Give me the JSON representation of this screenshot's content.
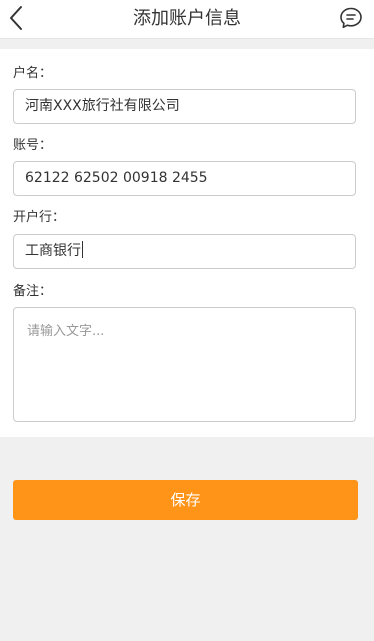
{
  "header": {
    "title": "添加账户信息",
    "back_icon": "chevron-left-icon",
    "chat_icon": "chat-bubble-icon"
  },
  "form": {
    "account_name": {
      "label": "户名：",
      "value": "河南XXX旅行社有限公司"
    },
    "account_number": {
      "label": "账号：",
      "value": "62122 62502 00918 2455"
    },
    "bank": {
      "label": "开户行：",
      "value": "工商银行"
    },
    "remark": {
      "label": "备注：",
      "placeholder": "请输入文字..."
    }
  },
  "actions": {
    "save_label": "保存"
  },
  "colors": {
    "accent": "#ff9419",
    "background": "#f0f0f0",
    "input_border": "#cccccc"
  }
}
